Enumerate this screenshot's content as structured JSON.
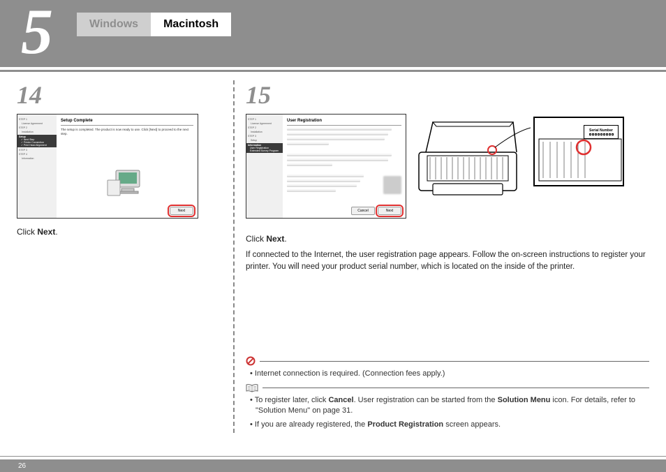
{
  "header": {
    "section_number": "5",
    "tab_inactive": "Windows",
    "tab_active": "Macintosh"
  },
  "step14": {
    "number": "14",
    "dialog": {
      "sidebar": {
        "step1": "STEP 1",
        "license": "License Agreement",
        "step2": "STEP 2",
        "installation": "Installation",
        "setup_heading": "Setup",
        "setup_item1": "Next Step",
        "setup_item2": "Printer Connection",
        "setup_item3": "Print Head Alignment",
        "step3": "STEP 3",
        "step4": "STEP 4",
        "information": "Information"
      },
      "title": "Setup Complete",
      "body": "The setup is completed. The product is now ready to use. Click [Next] to proceed to the next step.",
      "next_btn": "Next"
    },
    "instruction_prefix": "Click ",
    "instruction_bold": "Next",
    "instruction_suffix": "."
  },
  "step15": {
    "number": "15",
    "dialog": {
      "sidebar": {
        "step1": "STEP 1",
        "license": "License Agreement",
        "step2": "STEP 2",
        "installation": "Installation",
        "step3": "STEP 3",
        "setup": "Setup",
        "info_heading": "Information",
        "info_item1": "User Registration",
        "info_item2": "Extended Survey Program"
      },
      "title": "User Registration",
      "cancel_btn": "Cancel",
      "next_btn": "Next"
    },
    "serial_label": "Serial Number",
    "instruction_prefix": "Click ",
    "instruction_bold": "Next",
    "instruction_suffix": ".",
    "description": "If connected to the Internet, the user registration page appears. Follow the on-screen instructions to register your printer. You will need your product serial number, which is located on the inside of the printer.",
    "note1": "Internet connection is required. (Connection fees apply.)",
    "note2_a": "To register later, click ",
    "note2_b": "Cancel",
    "note2_c": ". User registration can be started from the ",
    "note2_d": "Solution Menu",
    "note2_e": " icon. For details, refer to \"Solution Menu\" on page 31.",
    "note3_a": "If you are already registered, the ",
    "note3_b": "Product Registration",
    "note3_c": " screen appears."
  },
  "footer": {
    "page": "26"
  }
}
